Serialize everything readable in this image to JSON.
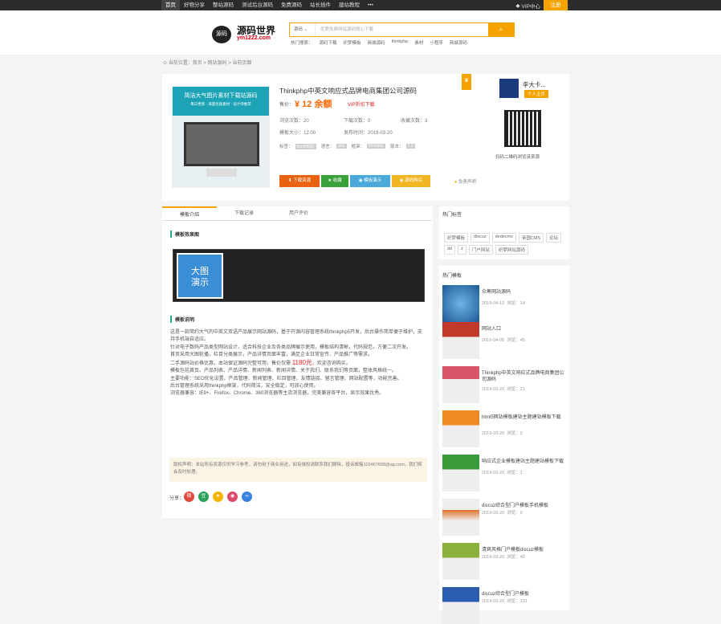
{
  "topnav": {
    "items": [
      "首页",
      "好物分享",
      "整站源码",
      "测试后台源码",
      "免费源码",
      "站长插件",
      "建站教程",
      "•••"
    ],
    "vip": "VIP中心",
    "login": "登录",
    "register": "注册"
  },
  "header": {
    "logo_text": "源码世界",
    "logo_url": "ym1222.com",
    "logo_mark": "源码",
    "search_scope": "源码",
    "search_placeholder": "优质免费网站源码随心下载",
    "search_icon": "search-icon",
    "hot_label": "热门搜索：",
    "hot": [
      "源码下载",
      "织梦模板",
      "商城源码",
      "thinkphp",
      "素材",
      "小程序",
      "商城源码"
    ]
  },
  "breadcrumb": "当前位置：首页 > 网站源码 > 当前页面",
  "product": {
    "thumb_title": "简洁大气图片素材下载站源码",
    "thumb_sub": "每日更新 · 海量优质素材 · 设计师推荐",
    "title": "Thinkphp中英文响应式品牌电商集团公司源码",
    "price_label": "售价：",
    "price": "¥ 12 余额",
    "vip": "VIP折扣下载",
    "meta": {
      "views": "浏览次数：20",
      "downloads": "下载次数：0",
      "favorites": "收藏次数：3",
      "size": "模板大小：12.00",
      "date": "发布时间：2019-03-20"
    },
    "tags": [
      {
        "k": "标签：",
        "v": "html5网站"
      },
      {
        "k": "语言：",
        "v": "php"
      },
      {
        "k": "框架：",
        "v": "thinkphp"
      },
      {
        "k": "版本：",
        "v": "1.0"
      }
    ],
    "buttons": {
      "download": "下载资源",
      "favorite": "收藏",
      "demo": "模板演示",
      "paid": "源码购买"
    },
    "notice": "免责声明",
    "badge": "VIP"
  },
  "user": {
    "name": "李大卡...",
    "badge": "个人主页",
    "qr_caption": "扫码二维码浏览该资源"
  },
  "tabs": [
    "模板介绍",
    "下载记录",
    "用户评价"
  ],
  "content": {
    "sec1": "模板效果图",
    "demo_label": "大图\n演示",
    "sec2": "模板说明",
    "desc": [
      "这是一款简约大气的中英文双语产品展示网站源码，基于开源内容管理系统thinkphp5开发，后台操作简单便于维护，支持手机端自适应。",
      "针对电子数码产品类型网站设计，适合科技企业及各类品牌展示使用，模板结构清晰，代码规范，方便二次开发。",
      "首页采用大图轮播，栏目分类展示，产品详情页面丰富，满足企业日常宣传、产品推广等需求。",
      "二手源码站价格优惠，本站保证源码完整可用，售价仅需",
      "，欢迎咨询购买。",
      "模板包括首页、产品列表、产品详情、新闻列表、新闻详情、关于我们、联系我们等页面，整体风格统一。",
      "主要功能：SEO优化设置、产品管理、新闻管理、栏目管理、友情链接、留言管理、网站配置等，功能完善。",
      "后台管理系统采用thinkphp框架，代码简洁，安全稳定，可放心使用。",
      "浏览器兼容：IE9+、Firefox、Chrome、360浏览器等主流浏览器，完美兼容各平台，显示效果优秀。"
    ],
    "price_hl": "1180元",
    "copyright": "版权声明：本站所有资源仅供学习参考，请勿用于商业用途，如有侵权请联系我们删除，投诉邮箱102467608@qq.com，我们将会及时处理。"
  },
  "share": {
    "label": "分享：",
    "icons": [
      "weibo-icon",
      "douban-icon",
      "qzone-icon",
      "wechat-icon",
      "link-icon"
    ]
  },
  "sidebar": {
    "hot_tags_title": "热门标签",
    "hot_tags": [
      "织梦模板",
      "discuz",
      "dedecms",
      "帝国CMS",
      "论坛",
      "dd",
      "z",
      "门户网站",
      "织梦网站源码"
    ],
    "hot_templates_title": "热门模板",
    "templates": [
      {
        "title": "众筹网站源码",
        "date": "2019-04-12",
        "views": "浏览：14"
      },
      {
        "title": "网站入口",
        "date": "2019-04-05",
        "views": "浏览：45"
      },
      {
        "title": "Thinkphp中英文响应式品牌电商集团公司源码",
        "date": "2019-03-20",
        "views": "浏览：21"
      },
      {
        "title": "html5网站模板建站主题建站模板下载",
        "date": "2019-03-20",
        "views": "浏览：0"
      },
      {
        "title": "响应式企业模板建站主题建站模板下载",
        "date": "2019-03-20",
        "views": "浏览：1"
      },
      {
        "title": "discuz综合型门户模板手机模板",
        "date": "2019-03-20",
        "views": "浏览：0"
      },
      {
        "title": "清爽风格门户模板discuz模板",
        "date": "2019-03-20",
        "views": "浏览：40"
      },
      {
        "title": "discuz综合型门户模板",
        "date": "2019-03-20",
        "views": "浏览：131"
      }
    ]
  }
}
